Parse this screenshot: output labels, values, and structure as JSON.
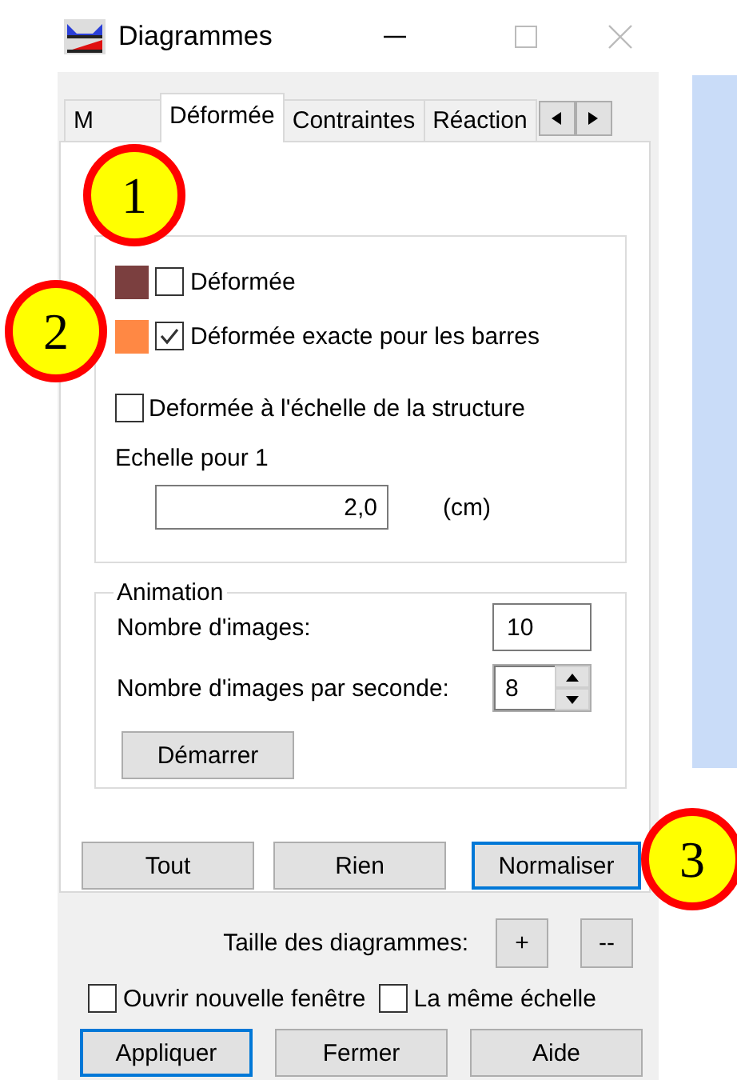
{
  "window": {
    "title": "Diagrammes"
  },
  "tabs": [
    {
      "label": "M",
      "selected": false
    },
    {
      "label": "Déformée",
      "selected": true
    },
    {
      "label": "Contraintes",
      "selected": false
    },
    {
      "label": "Réaction",
      "selected": false
    }
  ],
  "deformation": {
    "options": [
      {
        "kind": "colored",
        "color": "#7b3f3f",
        "label": "Déformée",
        "checked": false
      },
      {
        "kind": "colored",
        "color": "#ff8844",
        "label": "Déformée exacte pour les barres",
        "checked": true
      },
      {
        "kind": "plain",
        "label": "Deformée à l'échelle de la structure",
        "checked": false
      }
    ],
    "scale_label": "Echelle pour 1",
    "scale_value": "2,0",
    "scale_unit": "(cm)"
  },
  "animation": {
    "title": "Animation",
    "fields": [
      {
        "kind": "text",
        "label": "Nombre d'images:",
        "value": "10"
      },
      {
        "kind": "spin",
        "label": "Nombre d'images par seconde:",
        "value": "8"
      }
    ],
    "start_button": "Démarrer"
  },
  "panel_buttons": [
    {
      "label": "Tout",
      "focused": false
    },
    {
      "label": "Rien",
      "focused": false
    },
    {
      "label": "Normaliser",
      "focused": true
    }
  ],
  "size": {
    "label": "Taille des diagrammes:",
    "buttons": [
      "+",
      "--"
    ]
  },
  "options": [
    {
      "label": "Ouvrir nouvelle fenêtre",
      "checked": false
    },
    {
      "label": "La même échelle",
      "checked": false
    }
  ],
  "buttons": [
    {
      "label": "Appliquer",
      "focused": true
    },
    {
      "label": "Fermer",
      "focused": false
    },
    {
      "label": "Aide",
      "focused": false
    }
  ],
  "callouts": [
    "1",
    "2",
    "3"
  ]
}
